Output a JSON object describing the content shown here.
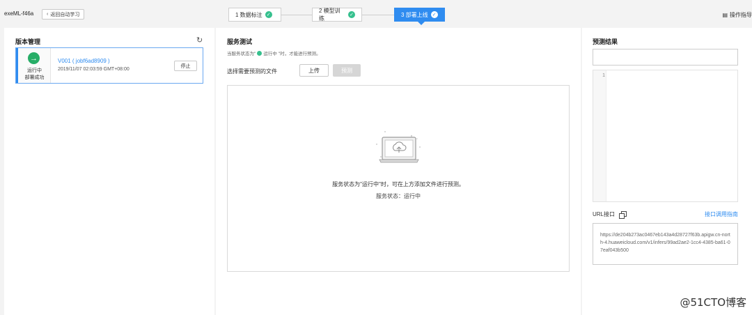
{
  "header": {
    "app_title": "exeML-f46a",
    "back_label": "返回自动学习",
    "steps": [
      {
        "label": "1 数据标注",
        "state": "done"
      },
      {
        "label": "2 模型训练",
        "state": "done"
      },
      {
        "label": "3 部署上线",
        "state": "active"
      }
    ],
    "guide_label": "操作指导"
  },
  "version_panel": {
    "title": "版本管理",
    "card": {
      "status_line1": "运行中",
      "status_line2": "部署成功",
      "version": "V001 ( jobf6ad8909 )",
      "time": "2019/11/07 02:03:59 GMT+08:00",
      "stop_label": "停止"
    }
  },
  "service_panel": {
    "title": "服务测试",
    "hint_prefix": "当服务状态为\"",
    "hint_status": "运行中",
    "hint_suffix": "\"时，才能进行预测。",
    "file_label": "选择需要预测的文件",
    "upload_label": "上传",
    "predict_label": "预测",
    "drop_message": "服务状态为\"运行中\"时，可在上方添加文件进行预测。",
    "drop_status": "服务状态：运行中"
  },
  "result_panel": {
    "title": "预测结果",
    "line_number": "1",
    "url_label": "URL接口",
    "api_guide_label": "接口调用指南",
    "url_value": "https://de204b273ac0467eb143a4d28727f63b.apigw.cn-north-4.huaweicloud.com/v1/infers/99ad2ae2-1cc4-4385-ba61-07eaf043b500"
  },
  "watermark": "@51CTO博客",
  "colors": {
    "accent": "#2f8cf0",
    "success": "#36c08e",
    "running": "#27ad67"
  }
}
